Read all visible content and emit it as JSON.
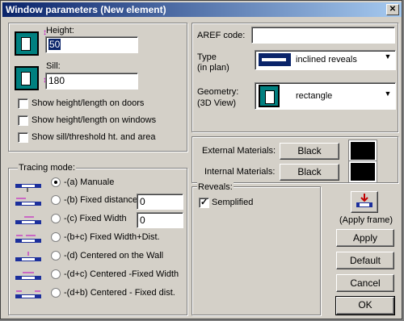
{
  "window": {
    "title": "Window parameters (New element)",
    "close": "✕"
  },
  "dimensions": {
    "height_label": "Height:",
    "height_value": "50",
    "sill_label": "Sill:",
    "sill_value": "180"
  },
  "aref": {
    "label": "AREF code:",
    "value": ""
  },
  "type": {
    "label_line1": "Type",
    "label_line2": "(in plan)",
    "selected": "inclined reveals"
  },
  "geometry": {
    "label_line1": "Geometry:",
    "label_line2": "(3D View)",
    "selected": "rectangle"
  },
  "checkboxes": {
    "doors": "Show height/length on doors",
    "windows": "Show height/length on windows",
    "sill_area": "Show sill/threshold ht. and area"
  },
  "materials": {
    "external_label": "External Materials:",
    "external_button": "Black",
    "internal_label": "Internal Materials:",
    "internal_button": "Black"
  },
  "reveals": {
    "group_label": "Reveals:",
    "semplified": "Semplified"
  },
  "tracing": {
    "group_label": "Tracing mode:",
    "options": [
      {
        "label": "-(a) Manuale"
      },
      {
        "label": "-(b) Fixed distance:",
        "value": "0"
      },
      {
        "label": "-(c) Fixed Width",
        "value": "0"
      },
      {
        "label": "-(b+c) Fixed Width+Dist."
      },
      {
        "label": "-(d) Centered on the Wall"
      },
      {
        "label": "-(d+c) Centered -Fixed Width"
      },
      {
        "label": "-(d+b) Centered - Fixed dist."
      }
    ]
  },
  "actions": {
    "apply_frame": "(Apply frame)",
    "apply": "Apply",
    "default": "Default",
    "cancel": "Cancel",
    "ok": "OK"
  },
  "colors": {
    "title_start": "#0a246a",
    "title_end": "#a6caf0",
    "teal": "#008080",
    "trace_blue": "#1c2f9c",
    "trace_magenta": "#c000c0"
  }
}
